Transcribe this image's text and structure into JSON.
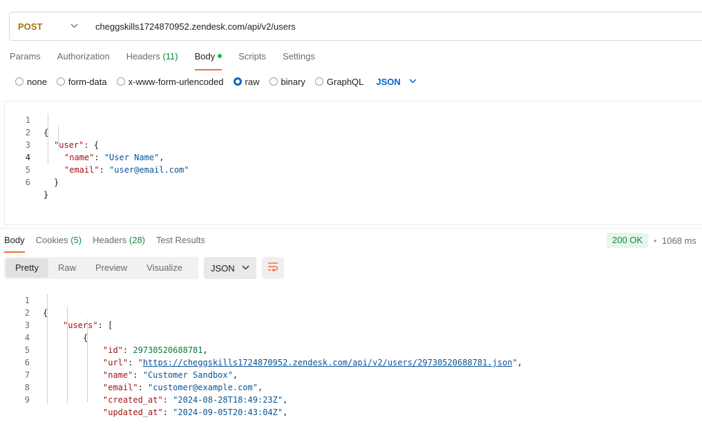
{
  "request": {
    "method": "POST",
    "url": "cheggskills1724870952.zendesk.com/api/v2/users"
  },
  "request_tabs": [
    {
      "label": "Params",
      "count": ""
    },
    {
      "label": "Authorization",
      "count": ""
    },
    {
      "label": "Headers",
      "count": "(11)"
    },
    {
      "label": "Body",
      "count": ""
    },
    {
      "label": "Scripts",
      "count": ""
    },
    {
      "label": "Settings",
      "count": ""
    }
  ],
  "body_types": [
    "none",
    "form-data",
    "x-www-form-urlencoded",
    "raw",
    "binary",
    "GraphQL"
  ],
  "body_format": "JSON",
  "request_body": {
    "line_numbers": [
      "1",
      "2",
      "3",
      "4",
      "5",
      "6"
    ],
    "l1": "{",
    "l2_key": "\"user\"",
    "l2_rest": ": {",
    "l3_key": "\"name\"",
    "l3_val": "\"User Name\"",
    "l4_key": "\"email\"",
    "l4_val": "\"user@email.com\"",
    "l5": "}",
    "l6": "}"
  },
  "response_tabs": [
    {
      "label": "Body",
      "count": ""
    },
    {
      "label": "Cookies",
      "count": "(5)"
    },
    {
      "label": "Headers",
      "count": "(28)"
    },
    {
      "label": "Test Results",
      "count": ""
    }
  ],
  "response_status": "200 OK",
  "response_time": "1068 ms",
  "response_separator": "•",
  "view_modes": [
    "Pretty",
    "Raw",
    "Preview",
    "Visualize"
  ],
  "response_format": "JSON",
  "response_body": {
    "line_numbers": [
      "1",
      "2",
      "3",
      "4",
      "5",
      "6",
      "7",
      "8",
      "9"
    ],
    "l1": "{",
    "l2_key": "\"users\"",
    "l2_rest": ": [",
    "l3": "{",
    "l4_key": "\"id\"",
    "l4_val": "29730520688781",
    "l5_key": "\"url\"",
    "l5_quote": "\"",
    "l5_link": "https://cheggskills1724870952.zendesk.com/api/v2/users/29730520688781.json",
    "l6_key": "\"name\"",
    "l6_val": "\"Customer Sandbox\"",
    "l7_key": "\"email\"",
    "l7_val": "\"customer@example.com\"",
    "l8_key": "\"created_at\"",
    "l8_val": "\"2024-08-28T18:49:23Z\"",
    "l9_key": "\"updated_at\"",
    "l9_val": "\"2024-09-05T20:43:04Z\""
  },
  "colors": {
    "method": "#a3770a",
    "accent_tab": "#f26b3a",
    "selection_blue": "#0265d2",
    "status_ok": "#0d8a3a"
  }
}
